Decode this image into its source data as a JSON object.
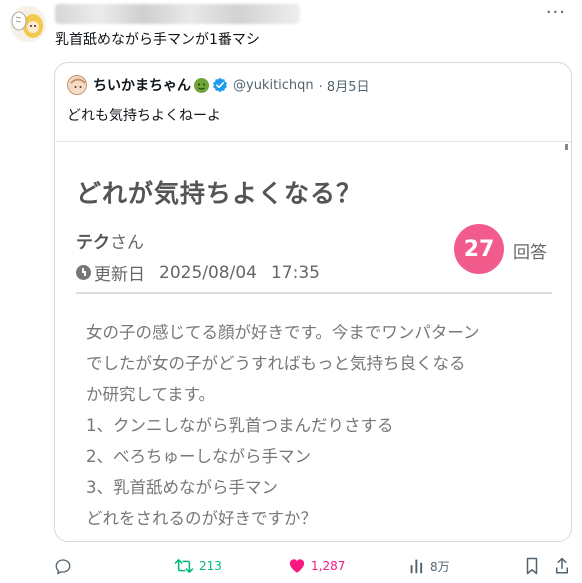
{
  "tweet": {
    "text": "乳首舐めながら手マンが1番マシ",
    "more_icon": "more-icon"
  },
  "quote": {
    "name": "ちいかまちゃん",
    "handle": "@yukitichqn",
    "date": "· 8月5日",
    "text": "どれも気持ちよくねーよ"
  },
  "card": {
    "title": "どれが気持ちよくなる？",
    "author_name": "テク",
    "author_suffix": "さん",
    "updated_label": "更新日",
    "updated_date": "2025/08/04",
    "updated_time": "17:35",
    "answer_count": "27",
    "answer_label": "回答",
    "body_lines": [
      "女の子の感じてる顔が好きです。今までワンパターン",
      "でしたが女の子がどうすればもっと気持ち良くなる",
      "か研究してます。",
      "1、クンニしながら乳首つまんだりさする",
      "2、べろちゅーしながら手マン",
      "3、乳首舐めながら手マン",
      "どれをされるのが好きですか？"
    ]
  },
  "actions": {
    "reply_count": "",
    "retweet_count": "213",
    "like_count": "1,287",
    "views_count": "8万"
  },
  "colors": {
    "retweet": "#00ba7c",
    "like": "#f91880",
    "badge": "#f25c8d",
    "verified": "#1d9bf0",
    "muted": "#536471"
  }
}
